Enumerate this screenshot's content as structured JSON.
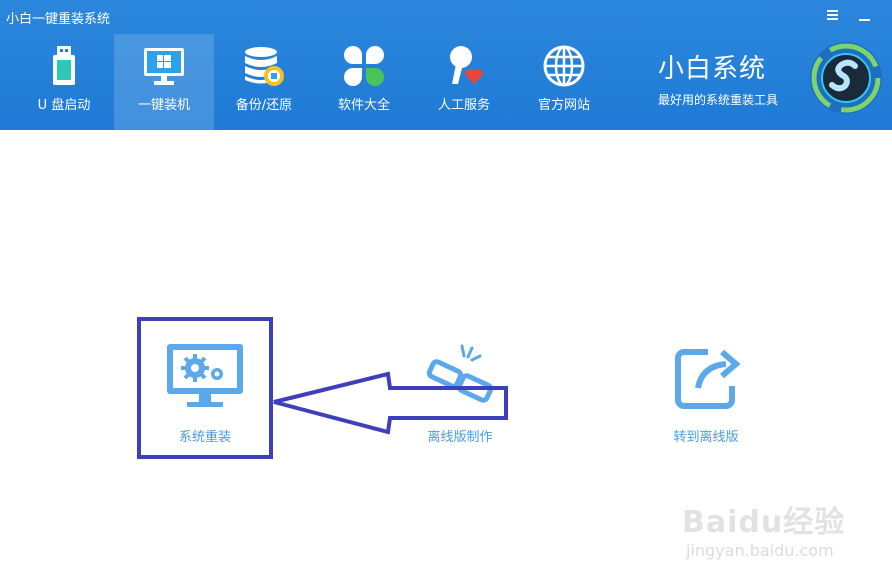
{
  "app": {
    "title": "小白一键重装系统"
  },
  "window_controls": {
    "menu": "menu-icon",
    "minimize": "minimize-icon"
  },
  "nav": {
    "items": [
      {
        "label": "U 盘启动",
        "icon": "usb-drive-icon",
        "active": false
      },
      {
        "label": "一键装机",
        "icon": "monitor-windows-icon",
        "active": true
      },
      {
        "label": "备份/还原",
        "icon": "database-backup-icon",
        "active": false
      },
      {
        "label": "软件大全",
        "icon": "clover-apps-icon",
        "active": false
      },
      {
        "label": "人工服务",
        "icon": "person-heart-icon",
        "active": false
      },
      {
        "label": "官方网站",
        "icon": "globe-icon",
        "active": false
      }
    ]
  },
  "brand": {
    "name": "小白系统",
    "tagline": "最好用的系统重装工具"
  },
  "actions": [
    {
      "label": "系统重装",
      "icon": "monitor-gears-icon"
    },
    {
      "label": "离线版制作",
      "icon": "broken-link-icon"
    },
    {
      "label": "转到离线版",
      "icon": "share-arrow-icon"
    }
  ],
  "colors": {
    "header": "#2280d8",
    "accent": "#4a9be0",
    "annotation": "#3d3fbb"
  },
  "watermark": {
    "text": "Baidu经验",
    "url": "jingyan.baidu.com"
  }
}
